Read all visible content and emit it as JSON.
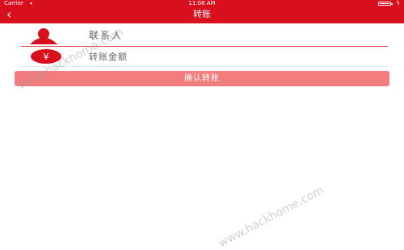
{
  "status_bar": {
    "carrier": "Carrier",
    "time": "11:08 AM"
  },
  "nav": {
    "title": "转账"
  },
  "contact": {
    "placeholder": "联系人"
  },
  "amount": {
    "placeholder": "转账金额"
  },
  "confirm": {
    "label": "确认转账"
  },
  "watermark": {
    "text": "www.hackhome.com"
  },
  "colors": {
    "accent": "#d8101e",
    "button": "#f27c7e"
  }
}
